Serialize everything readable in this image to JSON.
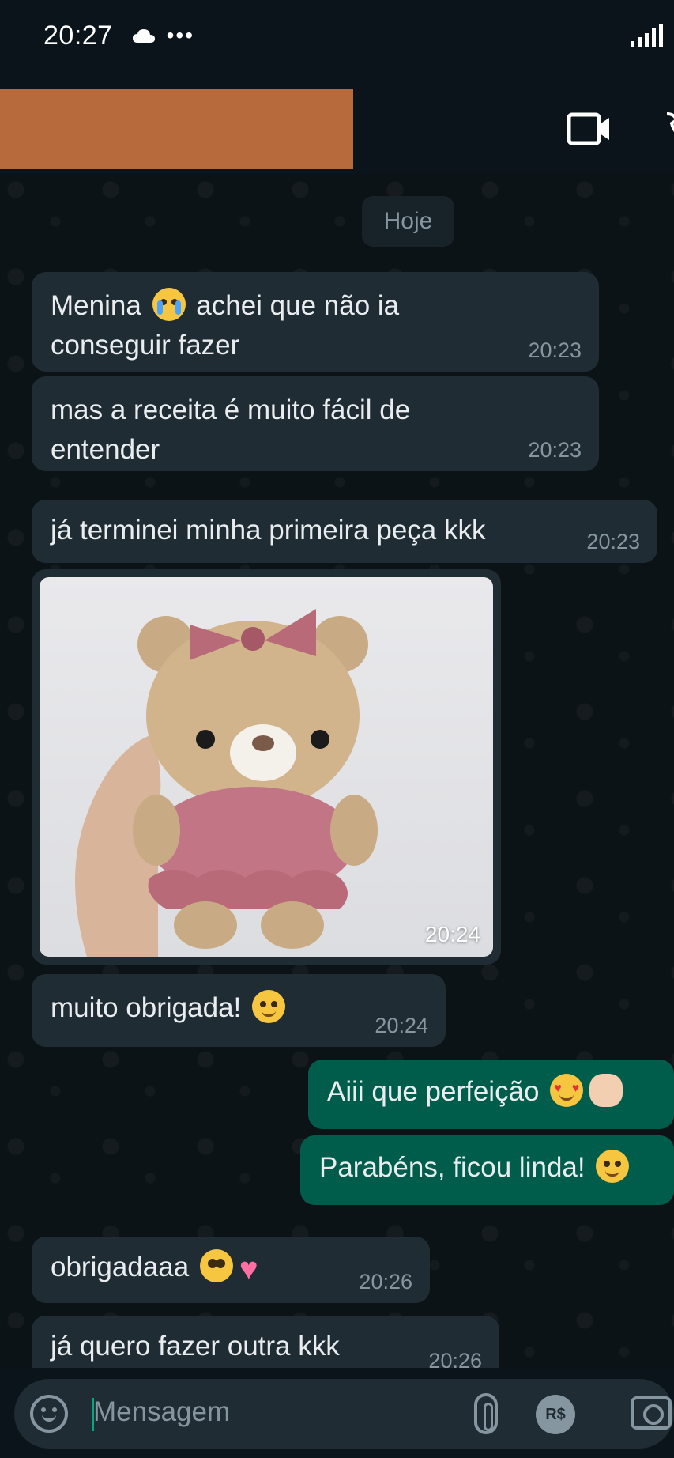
{
  "status_bar": {
    "time": "20:27",
    "dots": "•••"
  },
  "chat": {
    "date_chip": "Hoje",
    "messages": [
      {
        "line1": "Menina",
        "line1b": "achei que não ia",
        "line2": "conseguir fazer",
        "time": "20:23"
      },
      {
        "line1": "mas a receita é muito fácil de",
        "line2": "entender",
        "time": "20:23"
      },
      {
        "line1": "já terminei minha primeira peça kkk",
        "time": "20:23"
      },
      {
        "image_time": "20:24"
      },
      {
        "line1": "muito obrigada!",
        "time": "20:24"
      },
      {
        "line1": "Aiii que perfeição"
      },
      {
        "line1": "Parabéns, ficou linda!"
      },
      {
        "line1": "obrigadaaa",
        "time": "20:26"
      },
      {
        "line1": "já quero fazer outra kkk",
        "time": "20:26"
      }
    ]
  },
  "input": {
    "placeholder": "Mensagem",
    "rs_label": "R$"
  },
  "colors": {
    "incoming": "#202c33",
    "outgoing": "#005c4b",
    "background": "#0b141a",
    "accent": "#00a884"
  },
  "icons": [
    "cloud-icon",
    "signal-icon",
    "video-call-icon",
    "voice-call-icon",
    "emoji-icon",
    "attach-icon",
    "payment-icon",
    "camera-icon"
  ]
}
